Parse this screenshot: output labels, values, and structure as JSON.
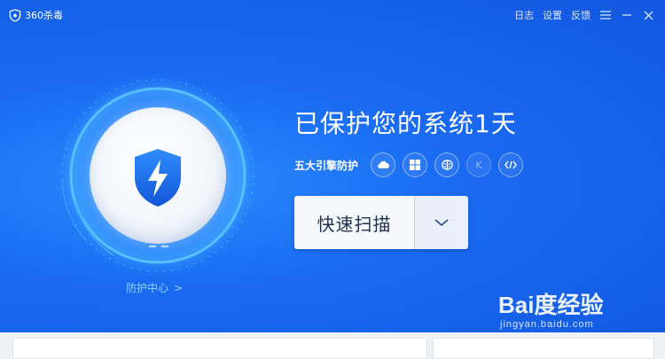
{
  "app": {
    "name": "360杀毒"
  },
  "titlebar": {
    "log": "日志",
    "settings": "设置",
    "feedback": "反馈"
  },
  "status": {
    "headline": "已保护您的系统1天"
  },
  "engines": {
    "label": "五大引擎防护",
    "items": [
      "cloud",
      "windows",
      "brain",
      "K",
      "code"
    ]
  },
  "scan": {
    "label": "快速扫描"
  },
  "protect_center": {
    "label": "防护中心",
    "chevron": ">"
  },
  "watermark": {
    "text": "Bai度经验",
    "url": "jingyan.baidu.com"
  },
  "colors": {
    "accent": "#1a6bf2",
    "ring": "#5cc6ff"
  }
}
